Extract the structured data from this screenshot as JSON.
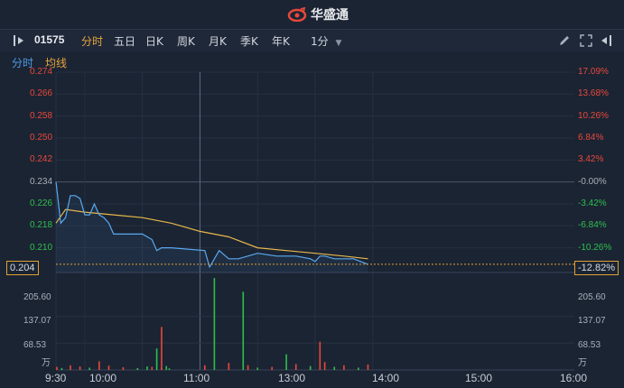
{
  "brand": {
    "name": "华盛通"
  },
  "toolbar": {
    "stock_code": "01575",
    "tabs": [
      "分时",
      "五日",
      "日K",
      "周K",
      "月K",
      "季K",
      "年K"
    ],
    "active_tab": "分时",
    "interval": "1分"
  },
  "subtabs": {
    "left": "分时",
    "right": "均线"
  },
  "price_axis": {
    "left_labels": [
      "0.274",
      "0.266",
      "0.258",
      "0.250",
      "0.242",
      "0.234",
      "0.226",
      "0.218",
      "0.210"
    ],
    "right_labels": [
      "17.09%",
      "13.68%",
      "10.26%",
      "6.84%",
      "3.42%",
      "-0.00%",
      "-3.42%",
      "-6.84%",
      "-10.26%"
    ],
    "current_price": "0.204",
    "current_change": "-12.82%"
  },
  "volume_axis": {
    "left_labels": [
      "205.60",
      "137.07",
      "68.53",
      "万"
    ],
    "right_labels": [
      "205.60",
      "137.07",
      "68.53",
      "万"
    ]
  },
  "x_axis": {
    "labels": [
      "9:30",
      "10:00",
      "11:00",
      "13:00",
      "14:00",
      "15:00",
      "16:00"
    ]
  },
  "colors": {
    "up": "#e8483b",
    "down": "#2fbf4e",
    "price_line": "#5aa9f0",
    "avg_line": "#e6b84a",
    "background": "#1b2433"
  },
  "chart_data": {
    "type": "line",
    "title": "",
    "prev_close": 0.234,
    "ylim": [
      0.201,
      0.274
    ],
    "series": [
      {
        "name": "分时",
        "x": [
          "9:30",
          "9:35",
          "9:40",
          "9:45",
          "9:50",
          "9:55",
          "10:00",
          "10:05",
          "10:10",
          "10:15",
          "10:20",
          "10:25",
          "10:30",
          "10:45",
          "11:00",
          "11:10",
          "11:15",
          "11:20",
          "11:30",
          "13:05",
          "13:10",
          "13:15",
          "13:20",
          "13:30",
          "13:40",
          "14:00",
          "14:20",
          "14:40",
          "14:55",
          "15:00",
          "15:05",
          "15:10",
          "15:20",
          "15:30",
          "15:40",
          "15:55"
        ],
        "values": [
          0.234,
          0.219,
          0.221,
          0.229,
          0.229,
          0.228,
          0.222,
          0.222,
          0.226,
          0.222,
          0.221,
          0.219,
          0.215,
          0.215,
          0.215,
          0.213,
          0.209,
          0.21,
          0.21,
          0.209,
          0.203,
          0.206,
          0.209,
          0.206,
          0.206,
          0.208,
          0.207,
          0.207,
          0.206,
          0.205,
          0.207,
          0.207,
          0.206,
          0.206,
          0.206,
          0.204
        ]
      },
      {
        "name": "均线",
        "x": [
          "9:30",
          "9:40",
          "10:00",
          "10:30",
          "11:00",
          "11:30",
          "13:00",
          "13:30",
          "14:00",
          "14:30",
          "15:00",
          "15:30",
          "15:55"
        ],
        "values": [
          0.219,
          0.224,
          0.223,
          0.222,
          0.221,
          0.219,
          0.216,
          0.214,
          0.21,
          0.209,
          0.208,
          0.207,
          0.206
        ]
      }
    ],
    "volume": {
      "ylim": [
        0,
        240
      ],
      "unit": "万",
      "bars": [
        {
          "t": "9:31",
          "v": 8,
          "dir": "up"
        },
        {
          "t": "9:36",
          "v": 5,
          "dir": "down"
        },
        {
          "t": "9:45",
          "v": 12,
          "dir": "up"
        },
        {
          "t": "9:55",
          "v": 9,
          "dir": "up"
        },
        {
          "t": "10:05",
          "v": 6,
          "dir": "down"
        },
        {
          "t": "10:15",
          "v": 22,
          "dir": "up"
        },
        {
          "t": "10:25",
          "v": 11,
          "dir": "up"
        },
        {
          "t": "10:40",
          "v": 7,
          "dir": "up"
        },
        {
          "t": "10:55",
          "v": 5,
          "dir": "down"
        },
        {
          "t": "11:10",
          "v": 8,
          "dir": "up"
        },
        {
          "t": "11:20",
          "v": 6,
          "dir": "up"
        },
        {
          "t": "11:28",
          "v": 4,
          "dir": "down"
        },
        {
          "t": "12:05",
          "v": 9,
          "dir": "down"
        },
        {
          "t": "12:15",
          "v": 55,
          "dir": "down"
        },
        {
          "t": "12:20",
          "v": 110,
          "dir": "up"
        },
        {
          "t": "12:25",
          "v": 10,
          "dir": "down"
        },
        {
          "t": "13:05",
          "v": 12,
          "dir": "up"
        },
        {
          "t": "13:15",
          "v": 235,
          "dir": "down"
        },
        {
          "t": "13:30",
          "v": 18,
          "dir": "up"
        },
        {
          "t": "13:45",
          "v": 200,
          "dir": "down"
        },
        {
          "t": "13:50",
          "v": 12,
          "dir": "up"
        },
        {
          "t": "14:00",
          "v": 6,
          "dir": "down"
        },
        {
          "t": "14:15",
          "v": 8,
          "dir": "up"
        },
        {
          "t": "14:30",
          "v": 40,
          "dir": "down"
        },
        {
          "t": "14:40",
          "v": 15,
          "dir": "up"
        },
        {
          "t": "14:55",
          "v": 10,
          "dir": "down"
        },
        {
          "t": "15:05",
          "v": 72,
          "dir": "up"
        },
        {
          "t": "15:10",
          "v": 20,
          "dir": "up"
        },
        {
          "t": "15:20",
          "v": 8,
          "dir": "down"
        },
        {
          "t": "15:30",
          "v": 12,
          "dir": "up"
        },
        {
          "t": "15:45",
          "v": 6,
          "dir": "down"
        },
        {
          "t": "15:55",
          "v": 14,
          "dir": "up"
        }
      ]
    }
  }
}
